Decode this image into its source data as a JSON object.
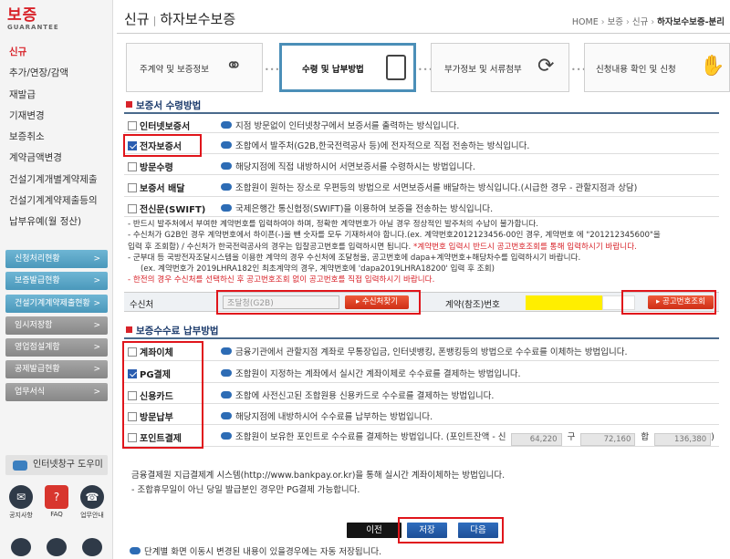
{
  "sidebar": {
    "logo_main": "보증",
    "logo_sub": "GUARANTEE",
    "menu": [
      "신규",
      "추가/연장/감액",
      "재발급",
      "기재변경",
      "보증취소",
      "계약금액변경",
      "건설기계개별계약제출",
      "건설기계계약제출등의",
      "납부유예(월 정산)"
    ],
    "buttons": [
      {
        "label": "신청처리현황",
        "style": "teal"
      },
      {
        "label": "보증발급현황",
        "style": "teal"
      },
      {
        "label": "건설기계계약제출현황",
        "style": "teal"
      },
      {
        "label": "임시저장함",
        "style": "gray"
      },
      {
        "label": "영업점설계함",
        "style": "gray"
      },
      {
        "label": "공제발급현황",
        "style": "gray"
      },
      {
        "label": "업무서식",
        "style": "gray"
      }
    ],
    "arrow": ">",
    "helper_label": "인터넷창구 도우미",
    "help_icons": [
      {
        "label": "공지사항",
        "icon": "megaphone-icon"
      },
      {
        "label": "FAQ",
        "icon": "faq-icon"
      },
      {
        "label": "업무안내",
        "icon": "phone-icon"
      }
    ]
  },
  "header": {
    "title_left": "신규",
    "title_sep": "|",
    "title_right": "하자보수보증",
    "breadcrumb": [
      "HOME",
      "보증",
      "신규",
      "하자보수보증-분리"
    ]
  },
  "steps": [
    {
      "label": "주계약 및 보증정보",
      "icon": "headphones-icon",
      "active": false
    },
    {
      "label": "수령 및 납부방법",
      "icon": "calculator-icon",
      "active": true
    },
    {
      "label": "부가정보 및 서류첨부",
      "icon": "refresh-icon",
      "active": false
    },
    {
      "label": "신청내용 확인 및 신청",
      "icon": "hand-icon",
      "active": false
    }
  ],
  "receive_section": {
    "title": "보증서 수령방법",
    "options": [
      {
        "label": "인터넷보증서",
        "checked": false,
        "desc": "지점 방문없이 인터넷창구에서 보증서를 출력하는 방식입니다."
      },
      {
        "label": "전자보증서",
        "checked": true,
        "desc": "조합에서 발주처(G2B,한국전력공사 등)에 전자적으로 직접 전송하는 방식입니다."
      },
      {
        "label": "방문수령",
        "checked": false,
        "desc": "해당지점에 직접 내방하시어 서면보증서를 수령하시는 방법입니다."
      },
      {
        "label": "보증서 배달",
        "checked": false,
        "desc": "조합원이 원하는 장소로 우편등의 방법으로 서면보증서를 배달하는 방식입니다.(시급한 경우 - 관할지점과 상담)"
      },
      {
        "label": "전신문(SWIFT)",
        "checked": false,
        "desc": "국제은행간 통신협정(SWIFT)을 이용하여 보증을 전송하는 방식입니다."
      }
    ],
    "notes": [
      "- 반드시 발주처에서 부여한 계약번호를 입력하여야 하며, 정확한 계약번호가 아닐 경우 정상적인 발주처의 수납이 불가합니다.",
      "- 수신처가 G2B인 경우 계약번호에서 하이픈(-)을 뺀 숫자를 모두 기재하셔야 합니다.(ex. 계약번호2012123456-00인 경우, 계약번호 에 \"201212345600\"을",
      "입력 후 조회함) / 수신처가 한국전력공사의 경우는 입찰공고번호를 입력하시면 됩니다.",
      "*계약번호 입력시 반드시 공고번호조회를 통해 입력하시기 바랍니다.",
      "- 군부대 등 국방전자조달시스템을 이용한 계약의 경우 수신처에 조달청을, 공고번호에 dapa+계약번호+해당차수를 입력하시기 바랍니다.",
      "(ex. 계약번호가 2019LHRA182인 최초계약의 경우, 계약번호에 'dapa2019LHRA18200' 입력 후 조회)",
      "- 한전의 경우 수신처를 선택하신 후 공고번호조회 없이 공고번호를 직접 입력하시기 바랍니다."
    ],
    "receiver_label": "수신처",
    "receiver_value": "조달청(G2B)",
    "receiver_search_btn": "수신처찾기",
    "contract_label": "계약(참조)번호",
    "notice_search_btn": "공고번호조회"
  },
  "payment_section": {
    "title": "보증수수료 납부방법",
    "options": [
      {
        "label": "계좌이체",
        "checked": false,
        "desc": "금융기관에서 관할지점 계좌로 무통장입금, 인터넷뱅킹, 폰뱅킹등의 방법으로 수수료를 이체하는 방법입니다."
      },
      {
        "label": "PG결제",
        "checked": true,
        "desc": "조합원이 지정하는 계좌에서 실시간 계좌이체로 수수료를 결제하는 방법입니다."
      },
      {
        "label": "신용카드",
        "checked": false,
        "desc": "조합에 사전신고된 조합원용 신용카드로 수수료를 결제하는 방법입니다."
      },
      {
        "label": "방문납부",
        "checked": false,
        "desc": "해당지점에 내방하시어 수수료를 납부하는 방법입니다."
      },
      {
        "label": "포인트결제",
        "checked": false,
        "desc": "조합원이 보유한 포인트로 수수료를 결제하는 방법입니다. (포인트잔액 - 신"
      }
    ],
    "points": {
      "new_value": "64,220",
      "old_label": "구",
      "old_value": "72,160",
      "sum_label": "합",
      "sum_value": "136,380",
      "close": ")"
    },
    "info_lines": [
      "금융결제원 지급결제계 시스템(http://www.bankpay.or.kr)을 통해 실시간 계좌이체하는 방법입니다.",
      "- 조합휴무일이 아닌 당일 발급분인 경우만 PG결제 가능합니다."
    ]
  },
  "nav": {
    "prev": "이전",
    "save": "저장",
    "next": "다음"
  },
  "bottom_note": "단계별 화면 이동시 변경된 내용이 있을경우에는 자동 저장됩니다.",
  "colors": {
    "accent_red": "#d8232a",
    "teal": "#4a98bb",
    "highlight": "#ffee00",
    "annotation": "#e0151b"
  }
}
